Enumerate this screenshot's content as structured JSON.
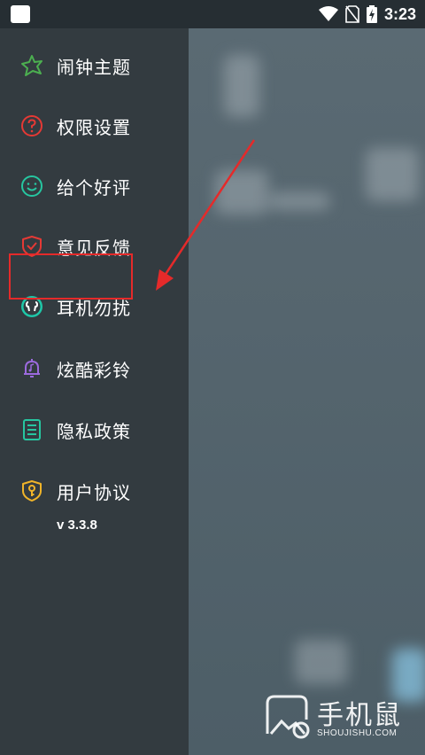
{
  "status_bar": {
    "time": "3:23"
  },
  "menu": {
    "items": [
      {
        "label": "闹钟主题",
        "icon": "star-theme-icon",
        "color": "#4caf50"
      },
      {
        "label": "权限设置",
        "icon": "question-circle-icon",
        "color": "#e53935"
      },
      {
        "label": "给个好评",
        "icon": "smiley-icon",
        "color": "#26c6a0"
      },
      {
        "label": "意见反馈",
        "icon": "shield-check-icon",
        "color": "#e53935"
      },
      {
        "label": "耳机勿扰",
        "icon": "earphones-icon",
        "color": "#1ec7a8"
      },
      {
        "label": "炫酷彩铃",
        "icon": "bell-music-icon",
        "color": "#9c6ade"
      },
      {
        "label": "隐私政策",
        "icon": "document-icon",
        "color": "#26c6a0"
      },
      {
        "label": "用户协议",
        "icon": "shield-key-icon",
        "color": "#f0b429"
      }
    ],
    "version": "v 3.3.8"
  },
  "watermark": {
    "text": "手机鼠",
    "url_text": "SHOUJISHU.COM"
  },
  "colors": {
    "drawer": "#333b40",
    "highlight": "#e52a2a"
  }
}
